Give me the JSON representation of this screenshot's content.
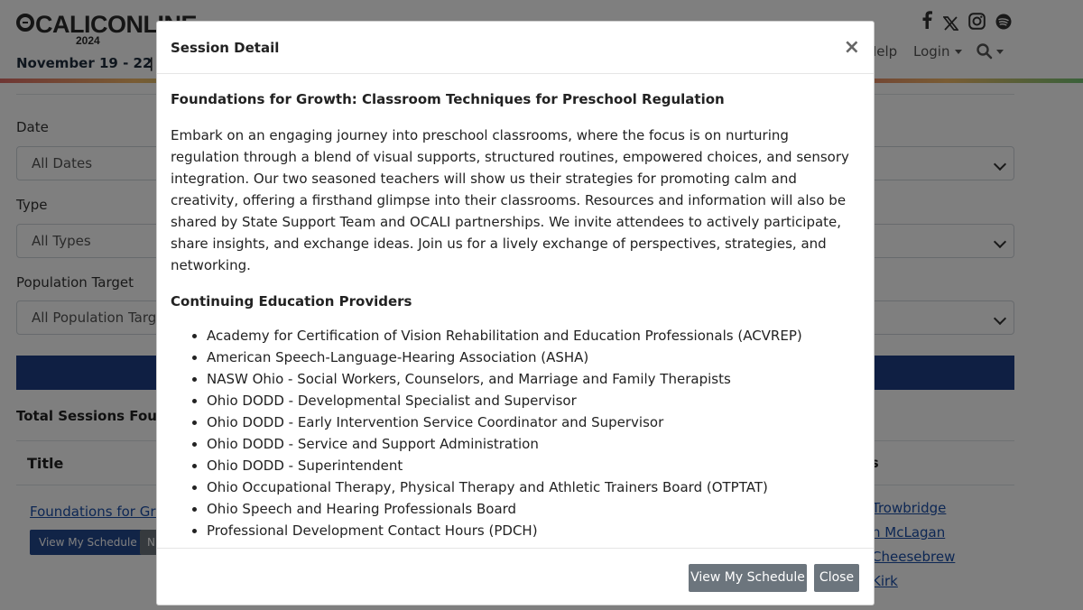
{
  "site": {
    "logo_text": "CALICONLINE",
    "logo_year": "2024",
    "event_dates": "November 19 - 22",
    "event_separator": "|"
  },
  "nav": {
    "help_label": "Help",
    "login_label": "Login",
    "social_icons": [
      "facebook-icon",
      "x-icon",
      "instagram-icon",
      "spotify-icon"
    ]
  },
  "filters": {
    "date_label": "Date",
    "date_value": "All Dates",
    "type_label": "Type",
    "type_value": "All Types",
    "population_label": "Population Target",
    "population_value": "All Population Targe"
  },
  "results": {
    "total_label": "Total Sessions Found",
    "col_title": "Title",
    "col_presenters": "ters",
    "row_title": "Foundations for Gro",
    "row_schedule_button": "View My Schedule",
    "row_second_button": "N",
    "presenters": [
      " Trowbridge",
      "n McLagan",
      " Cheesebrew",
      "Kirk"
    ]
  },
  "modal": {
    "title": "Session Detail",
    "close_symbol": "×",
    "session_title": "Foundations for Growth: Classroom Techniques for Preschool Regulation",
    "description": "Embark on an engaging journey into preschool classrooms, where the focus is on nurturing regulation through a blend of visual supports, structured routines, empowered choices, and sensory integration. Our two seasoned teachers will show us their strategies for promoting calm and creativity, offering a firsthand glimpse into their classrooms. Resources and information will also be shared by State Support Team and OCALI partnerships. We invite attendees to actively participate, share insights, and exchange ideas. Join us for a lively exchange of perspectives, strategies, and networking.",
    "ceu_heading": "Continuing Education Providers",
    "providers": [
      "Academy for Certification of Vision Rehabilitation and Education Professionals (ACVREP)",
      "American Speech-Language-Hearing Association (ASHA)",
      "NASW Ohio - Social Workers, Counselors, and Marriage and Family Therapists",
      "Ohio DODD - Developmental Specialist and Supervisor",
      "Ohio DODD - Early Intervention Service Coordinator and Supervisor",
      "Ohio DODD - Service and Support Administration",
      "Ohio DODD - Superintendent",
      "Ohio Occupational Therapy, Physical Therapy and Athletic Trainers Board (OTPTAT)",
      "Ohio Speech and Hearing Professionals Board",
      "Professional Development Contact Hours (PDCH)"
    ],
    "footer": {
      "schedule_button": "View My Schedule",
      "close_button": "Close"
    }
  },
  "colors": {
    "primary_blue": "#1e3f86",
    "secondary_gray": "#6c757d",
    "link_blue": "#1a4ea8",
    "backdrop": "rgba(0,0,0,0.5)"
  }
}
